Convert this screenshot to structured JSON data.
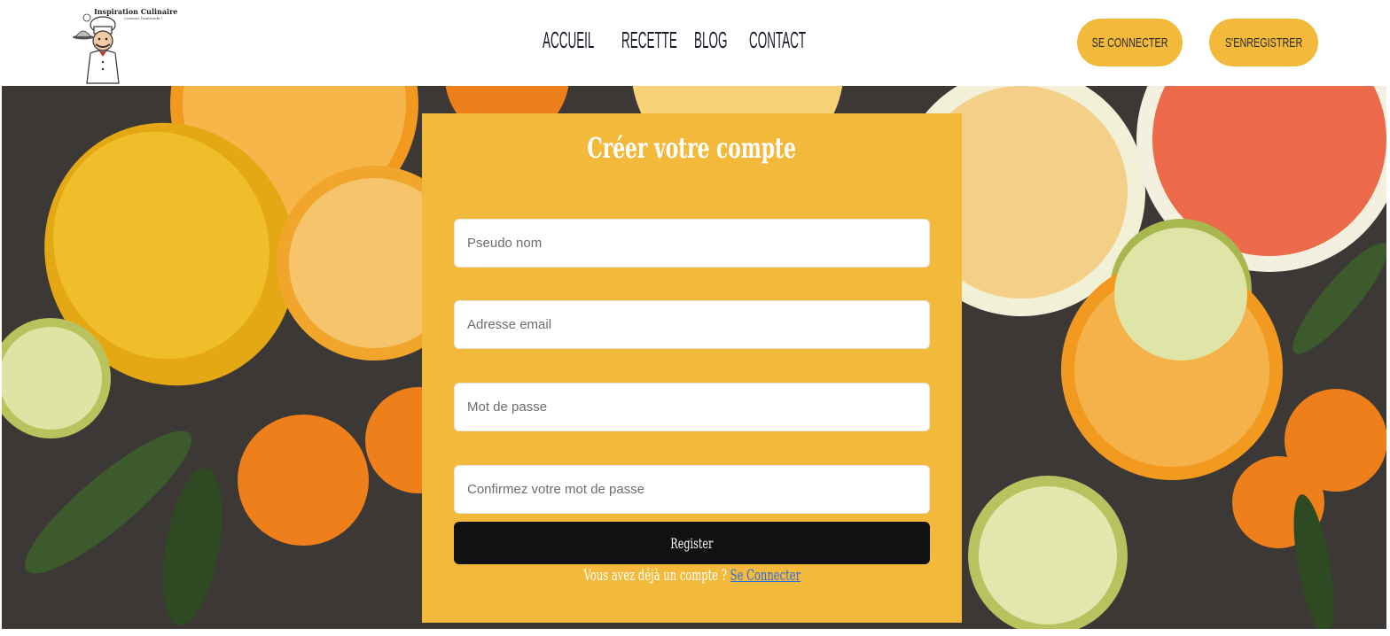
{
  "logo": {
    "title": "Inspiration Culinaire",
    "subtitle": "Cuisinez l'inattendu !"
  },
  "nav": {
    "items": [
      "ACCUEIL",
      "RECETTE",
      "BLOG",
      "CONTACT"
    ]
  },
  "header_buttons": {
    "login": "SE CONNECTER",
    "register": "S'ENREGISTRER"
  },
  "form": {
    "title": "Créer votre compte",
    "username_placeholder": "Pseudo nom",
    "email_placeholder": "Adresse email",
    "password_placeholder": "Mot de passe",
    "confirm_placeholder": "Confirmez votre mot de passe",
    "submit_label": "Register",
    "footer_text": "Vous avez déjà un compte ?",
    "footer_link": "Se Connecter"
  },
  "colors": {
    "accent": "#f3b93b",
    "button_dark": "#111111",
    "link": "#2c6be0"
  }
}
